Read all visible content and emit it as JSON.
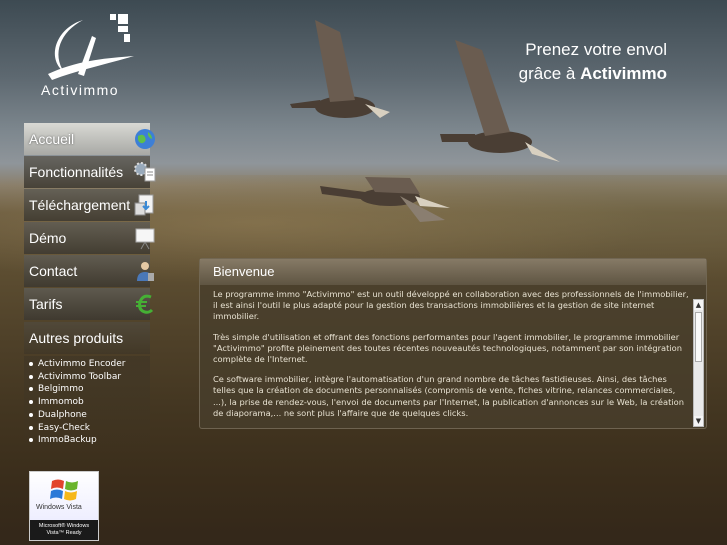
{
  "brand": {
    "logo_text": "Activimmo",
    "tagline_line1": "Prenez votre envol",
    "tagline_prefix": "grâce à ",
    "tagline_brand": "Activimmo"
  },
  "nav": {
    "items": [
      {
        "label": "Accueil",
        "icon": "globe-icon",
        "active": true
      },
      {
        "label": "Fonctionnalités",
        "icon": "gears-document-icon"
      },
      {
        "label": "Téléchargement",
        "icon": "download-icon"
      },
      {
        "label": "Démo",
        "icon": "presentation-board-icon"
      },
      {
        "label": "Contact",
        "icon": "person-phone-icon"
      },
      {
        "label": "Tarifs",
        "icon": "euro-icon"
      }
    ]
  },
  "other_products": {
    "title": "Autres produits",
    "items": [
      "Activimmo Encoder",
      "Activimmo Toolbar",
      "Belgimmo",
      "Immomob",
      "Dualphone",
      "Easy-Check",
      "ImmoBackup"
    ]
  },
  "vista_badge": {
    "logo_text": "Windows Vista",
    "line1": "Microsoft® Windows",
    "line2": "Vista™ Ready"
  },
  "welcome": {
    "title": "Bienvenue",
    "paragraphs": [
      "Le programme immo \"Activimmo\" est un outil développé en collaboration avec des professionnels de l'immobilier, il est ainsi l'outil le plus adapté pour la gestion des transactions immobilières et la gestion de site internet immobilier.",
      "Très simple d'utilisation et offrant des fonctions performantes pour l'agent immobilier, le programme immobilier \"Activimmo\" profite pleinement des toutes récentes nouveautés technologiques, notamment par son intégration complète de l'Internet.",
      "Ce software immobilier, intègre l'automatisation d'un grand nombre de tâches fastidieuses. Ainsi, des tâches telles que la création de documents personnalisés (compromis de vente, fiches vitrine, relances commerciales, ...), la prise de rendez-vous, l'envoi de documents par l'Internet, la publication d'annonces sur le Web, la création de diaporama,... ne sont plus l'affaire que de quelques clicks."
    ]
  },
  "colors": {
    "panel_bg": "#483e2c",
    "nav_active": "#c8c8c3",
    "text_light": "#e8e2d2"
  }
}
